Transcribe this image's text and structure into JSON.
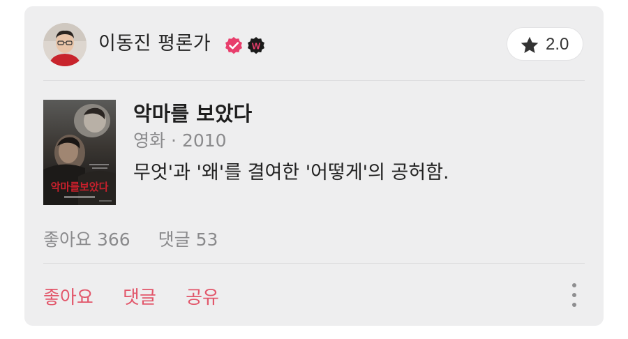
{
  "review": {
    "author": {
      "name": "이동진 평론가",
      "avatar_icon": "critic-avatar",
      "verified_icon": "verified-check-icon",
      "badge_icon": "w-badge-icon",
      "badge_letter": "W"
    },
    "rating": {
      "icon": "star-icon",
      "value": "2.0"
    },
    "work": {
      "poster_icon": "movie-poster",
      "poster_title": "악마를보았다",
      "title": "악마를 보았다",
      "category": "영화",
      "separator": "·",
      "year": "2010"
    },
    "text": "무엇'과 '왜'를 결여한 '어떻게'의 공허함.",
    "stats": {
      "likes": "좋아요 366",
      "comments": "댓글 53"
    },
    "actions": {
      "like": "좋아요",
      "comment": "댓글",
      "share": "공유",
      "more_icon": "more-vertical-icon"
    }
  },
  "colors": {
    "card_background": "#eeeeef",
    "accent": "#e2566a",
    "badge_pink": "#e83e6c",
    "muted_text": "#8a8a8c"
  }
}
